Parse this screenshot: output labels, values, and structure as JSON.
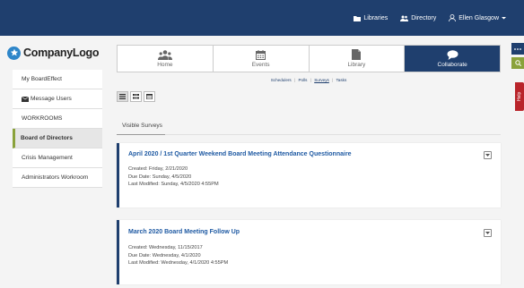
{
  "topnav": {
    "libraries": "Libraries",
    "directory": "Directory",
    "user": "Ellen Glasgow"
  },
  "logo": {
    "text": "CompanyLogo"
  },
  "sidebar": {
    "items": [
      {
        "label": "My BoardEffect"
      },
      {
        "label": "Message Users"
      },
      {
        "label": "WORKROOMS"
      },
      {
        "label": "Board of Directors"
      },
      {
        "label": "Crisis Management"
      },
      {
        "label": "Administrators Workroom"
      }
    ]
  },
  "tabs": [
    {
      "label": "Home",
      "icon": "users-icon"
    },
    {
      "label": "Events",
      "icon": "calendar-icon"
    },
    {
      "label": "Library",
      "icon": "document-icon"
    },
    {
      "label": "Collaborate",
      "icon": "chat-icon",
      "active": true
    }
  ],
  "subtabs": {
    "schedulers": "Schedulers",
    "polls": "Polls",
    "surveys": "Surveys",
    "tasks": "Tasks",
    "sep": "|"
  },
  "section": {
    "label": "Visible Surveys"
  },
  "surveys": [
    {
      "title": "April 2020 / 1st Quarter Weekend Board Meeting Attendance Questionnaire",
      "created": "Created: Friday, 2/21/2020",
      "due": "Due Date: Sunday, 4/5/2020",
      "modified": "Last Modified: Sunday, 4/5/2020 4:55PM"
    },
    {
      "title": "March 2020 Board Meeting Follow Up",
      "created": "Created: Wednesday, 11/15/2017",
      "due": "Due Date: Wednesday, 4/1/2020",
      "modified": "Last Modified: Wednesday, 4/1/2020 4:55PM"
    }
  ],
  "help": {
    "label": "Help"
  },
  "colors": {
    "navy": "#1f3f6e",
    "accent": "#8aa23b",
    "help": "#b9242a",
    "link": "#1f5aa3"
  }
}
